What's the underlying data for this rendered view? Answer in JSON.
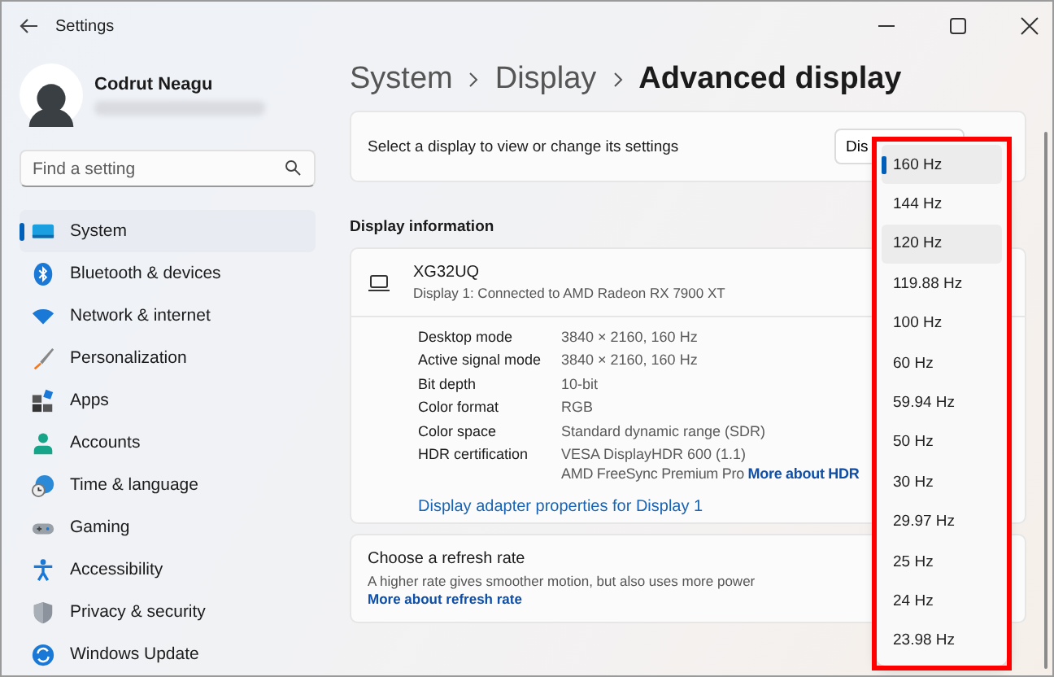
{
  "window": {
    "title": "Settings"
  },
  "profile": {
    "name": "Codrut Neagu"
  },
  "search": {
    "placeholder": "Find a setting"
  },
  "sidebar": {
    "items": [
      {
        "label": "System",
        "selected": true
      },
      {
        "label": "Bluetooth & devices",
        "selected": false
      },
      {
        "label": "Network & internet",
        "selected": false
      },
      {
        "label": "Personalization",
        "selected": false
      },
      {
        "label": "Apps",
        "selected": false
      },
      {
        "label": "Accounts",
        "selected": false
      },
      {
        "label": "Time & language",
        "selected": false
      },
      {
        "label": "Gaming",
        "selected": false
      },
      {
        "label": "Accessibility",
        "selected": false
      },
      {
        "label": "Privacy & security",
        "selected": false
      },
      {
        "label": "Windows Update",
        "selected": false
      }
    ]
  },
  "breadcrumb": [
    "System",
    "Display",
    "Advanced display"
  ],
  "display_select": {
    "label": "Select a display to view or change its settings",
    "button": "Dis"
  },
  "display_information": {
    "heading": "Display information",
    "monitor": "XG32UQ",
    "connection": "Display 1: Connected to AMD Radeon RX 7900 XT",
    "rows": [
      {
        "label": "Desktop mode",
        "value": "3840 × 2160, 160 Hz"
      },
      {
        "label": "Active signal mode",
        "value": "3840 × 2160, 160 Hz"
      },
      {
        "label": "Bit depth",
        "value": "10-bit"
      },
      {
        "label": "Color format",
        "value": "RGB"
      },
      {
        "label": "Color space",
        "value": "Standard dynamic range (SDR)"
      },
      {
        "label": "HDR certification",
        "value": "VESA DisplayHDR 600 (1.1)",
        "value_2": "AMD FreeSync Premium Pro",
        "link": "More about HDR"
      }
    ],
    "adapter_link": "Display adapter properties for Display 1"
  },
  "refresh_rate": {
    "title": "Choose a refresh rate",
    "description": "A higher rate gives smoother motion, but also uses more power",
    "link": "More about refresh rate"
  },
  "dropdown": {
    "options": [
      {
        "label": "160 Hz",
        "selected": true,
        "hovered": false
      },
      {
        "label": "144 Hz",
        "selected": false,
        "hovered": false
      },
      {
        "label": "120 Hz",
        "selected": false,
        "hovered": true
      },
      {
        "label": "119.88 Hz",
        "selected": false,
        "hovered": false
      },
      {
        "label": "100 Hz",
        "selected": false,
        "hovered": false
      },
      {
        "label": "60 Hz",
        "selected": false,
        "hovered": false
      },
      {
        "label": "59.94 Hz",
        "selected": false,
        "hovered": false
      },
      {
        "label": "50 Hz",
        "selected": false,
        "hovered": false
      },
      {
        "label": "30 Hz",
        "selected": false,
        "hovered": false
      },
      {
        "label": "29.97 Hz",
        "selected": false,
        "hovered": false
      },
      {
        "label": "25 Hz",
        "selected": false,
        "hovered": false
      },
      {
        "label": "24 Hz",
        "selected": false,
        "hovered": false
      },
      {
        "label": "23.98 Hz",
        "selected": false,
        "hovered": false
      }
    ]
  }
}
